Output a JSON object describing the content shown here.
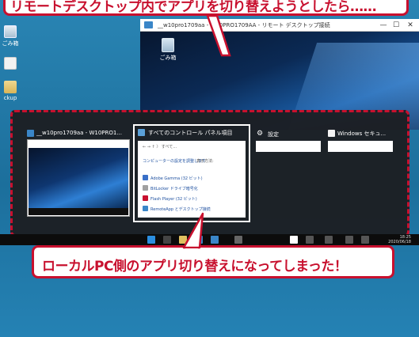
{
  "callouts": {
    "top": "リモートデスクトップ内でアプリを切り替えようとしたら……",
    "bottom": "ローカルPC側のアプリ切り替えになってしまった！"
  },
  "local_desktop": {
    "icons": [
      {
        "label": "ごみ箱",
        "name": "recycle-bin-icon"
      },
      {
        "label": "",
        "name": "file-icon"
      },
      {
        "label": "ckup",
        "name": "backup-icon"
      }
    ]
  },
  "remote_window": {
    "title": "__w10pro1709aa - W10PRO1709AA - リモート デスクトップ接続",
    "controls": [
      "—",
      "☐",
      "✕"
    ],
    "desktop_icon_label": "ごみ箱"
  },
  "task_switcher": {
    "items": [
      {
        "title": "__w10pro1709aa - W10PRO1...",
        "name": "rdp"
      },
      {
        "title": "すべてのコントロール パネル項目",
        "name": "control-panel"
      },
      {
        "title": "設定",
        "name": "settings"
      },
      {
        "title": "Windows セキュ...",
        "name": "windows-security"
      }
    ],
    "control_panel_preview": {
      "breadcrumb": "← → ↑ 〉 すべて...",
      "heading": "コンピューターの設定を調整します",
      "view_by": "表示方法:",
      "entries": [
        "Adobe Gamma (32 ビット)",
        "BitLocker ドライブ暗号化",
        "Flash Player (32 ビット)",
        "RemoteApp とデスクトップ接続"
      ]
    }
  },
  "taskbar": {
    "time": "18:25",
    "date": "2020/06/18"
  },
  "colors": {
    "accent_red": "#c8102e",
    "desktop_blue": "#1f7aa8"
  }
}
